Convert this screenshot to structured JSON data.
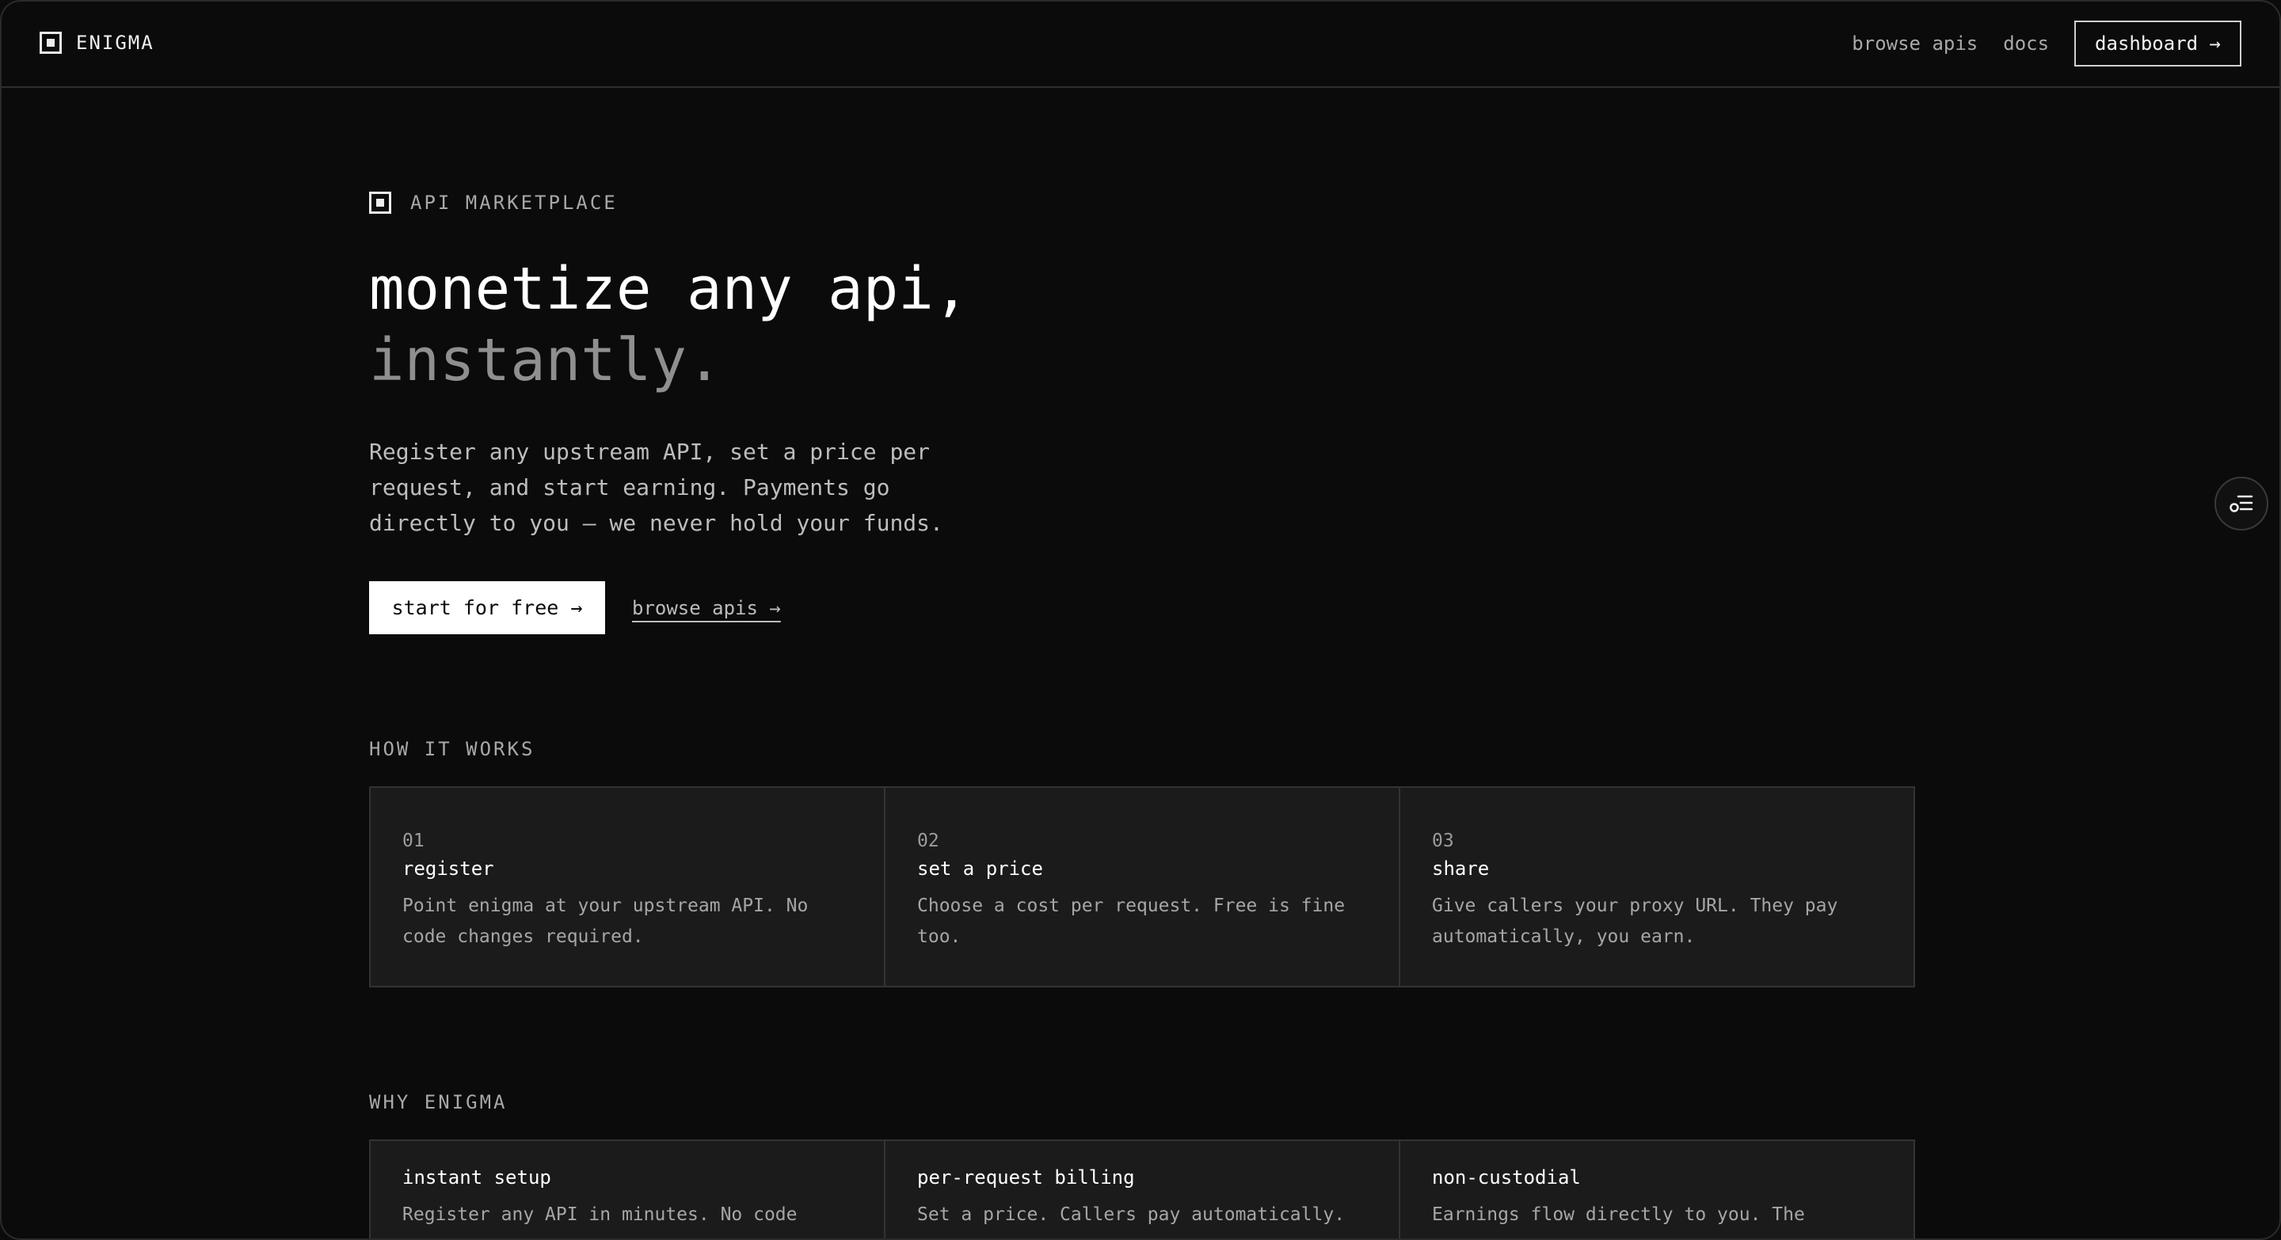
{
  "header": {
    "brand": "ENIGMA",
    "nav": {
      "browse": "browse apis",
      "docs": "docs",
      "dashboard": "dashboard →"
    }
  },
  "hero": {
    "eyebrow": "API MARKETPLACE",
    "title_line1": "monetize any api,",
    "title_line2": "instantly.",
    "description": "Register any upstream API, set a price per request, and start earning. Payments go directly to you — we never hold your funds.",
    "primary_cta": "start for free →",
    "secondary_cta": "browse apis →"
  },
  "how_it_works": {
    "label": "HOW IT WORKS",
    "steps": [
      {
        "num": "01",
        "title": "register",
        "desc": "Point enigma at your upstream API. No code changes required."
      },
      {
        "num": "02",
        "title": "set a price",
        "desc": "Choose a cost per request. Free is fine too."
      },
      {
        "num": "03",
        "title": "share",
        "desc": "Give callers your proxy URL. They pay automatically, you earn."
      }
    ]
  },
  "why": {
    "label": "WHY ENIGMA",
    "features": [
      {
        "title": "instant setup",
        "desc": "Register any API in minutes. No code"
      },
      {
        "title": "per-request billing",
        "desc": "Set a price. Callers pay automatically."
      },
      {
        "title": "non-custodial",
        "desc": "Earnings flow directly to you. The"
      }
    ]
  },
  "icons": {
    "brand": "square-logo-icon",
    "eyebrow": "square-logo-icon",
    "widget": "list-settings-icon"
  }
}
